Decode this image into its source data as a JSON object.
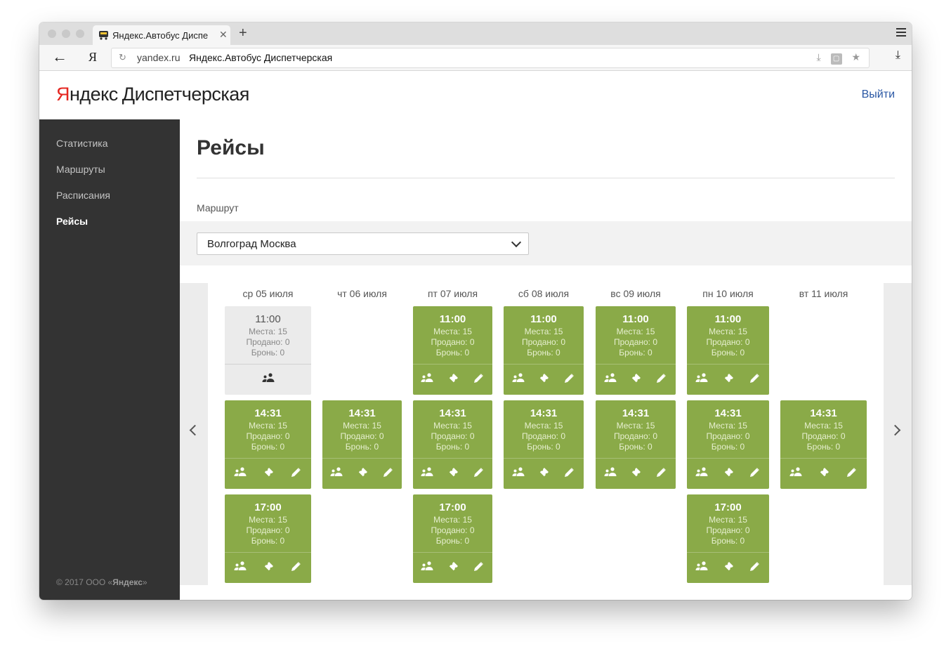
{
  "browser": {
    "tab_title": "Яндекс.Автобус Диспе",
    "tab_close": "✕",
    "new_tab": "+",
    "back": "←",
    "ya_button": "Я",
    "reload": "↻",
    "domain": "yandex.ru",
    "page_title": "Яндекс.Автобус Диспетчерская"
  },
  "header": {
    "logo_ya": "Я",
    "logo_rest": "ндекс",
    "logo_product": "Диспетчерская",
    "logout": "Выйти"
  },
  "sidebar": {
    "items": [
      {
        "label": "Статистика",
        "active": false
      },
      {
        "label": "Маршруты",
        "active": false
      },
      {
        "label": "Расписания",
        "active": false
      },
      {
        "label": "Рейсы",
        "active": true
      }
    ],
    "copyright_prefix": "© 2017 ООО «",
    "copyright_brand": "Яндекс",
    "copyright_suffix": "»"
  },
  "main": {
    "title": "Рейсы",
    "route_label": "Маршрут",
    "route_value": "Волгоград Москва",
    "days": [
      {
        "label": "ср 05 июля",
        "trips": [
          {
            "time": "11:00",
            "seats": "Места: 15",
            "sold": "Продано: 0",
            "booked": "Бронь: 0",
            "status": "past"
          },
          {
            "time": "14:31",
            "seats": "Места: 15",
            "sold": "Продано: 0",
            "booked": "Бронь: 0",
            "status": "active"
          },
          {
            "time": "17:00",
            "seats": "Места: 15",
            "sold": "Продано: 0",
            "booked": "Бронь: 0",
            "status": "active"
          }
        ]
      },
      {
        "label": "чт 06 июля",
        "trips": [
          null,
          {
            "time": "14:31",
            "seats": "Места: 15",
            "sold": "Продано: 0",
            "booked": "Бронь: 0",
            "status": "active"
          },
          null
        ]
      },
      {
        "label": "пт 07 июля",
        "trips": [
          {
            "time": "11:00",
            "seats": "Места: 15",
            "sold": "Продано: 0",
            "booked": "Бронь: 0",
            "status": "active"
          },
          {
            "time": "14:31",
            "seats": "Места: 15",
            "sold": "Продано: 0",
            "booked": "Бронь: 0",
            "status": "active"
          },
          {
            "time": "17:00",
            "seats": "Места: 15",
            "sold": "Продано: 0",
            "booked": "Бронь: 0",
            "status": "active"
          }
        ]
      },
      {
        "label": "сб 08 июля",
        "trips": [
          {
            "time": "11:00",
            "seats": "Места: 15",
            "sold": "Продано: 0",
            "booked": "Бронь: 0",
            "status": "active"
          },
          {
            "time": "14:31",
            "seats": "Места: 15",
            "sold": "Продано: 0",
            "booked": "Бронь: 0",
            "status": "active"
          },
          null
        ]
      },
      {
        "label": "вс 09 июля",
        "trips": [
          {
            "time": "11:00",
            "seats": "Места: 15",
            "sold": "Продано: 0",
            "booked": "Бронь: 0",
            "status": "active"
          },
          {
            "time": "14:31",
            "seats": "Места: 15",
            "sold": "Продано: 0",
            "booked": "Бронь: 0",
            "status": "active"
          },
          null
        ]
      },
      {
        "label": "пн 10 июля",
        "trips": [
          {
            "time": "11:00",
            "seats": "Места: 15",
            "sold": "Продано: 0",
            "booked": "Бронь: 0",
            "status": "active"
          },
          {
            "time": "14:31",
            "seats": "Места: 15",
            "sold": "Продано: 0",
            "booked": "Бронь: 0",
            "status": "active"
          },
          {
            "time": "17:00",
            "seats": "Места: 15",
            "sold": "Продано: 0",
            "booked": "Бронь: 0",
            "status": "active"
          }
        ]
      },
      {
        "label": "вт 11 июля",
        "trips": [
          null,
          {
            "time": "14:31",
            "seats": "Места: 15",
            "sold": "Продано: 0",
            "booked": "Бронь: 0",
            "status": "active"
          },
          null
        ]
      }
    ]
  },
  "icons": {
    "passengers": "passengers-icon",
    "ticket": "ticket-icon",
    "edit": "pencil-icon",
    "prev": "chevron-left-icon",
    "next": "chevron-right-icon"
  },
  "colors": {
    "sidebar_bg": "#333333",
    "card_active": "#8aaa48",
    "card_past": "#ebebeb",
    "logout_link": "#2a57a4",
    "logo_red": "#e52620"
  }
}
